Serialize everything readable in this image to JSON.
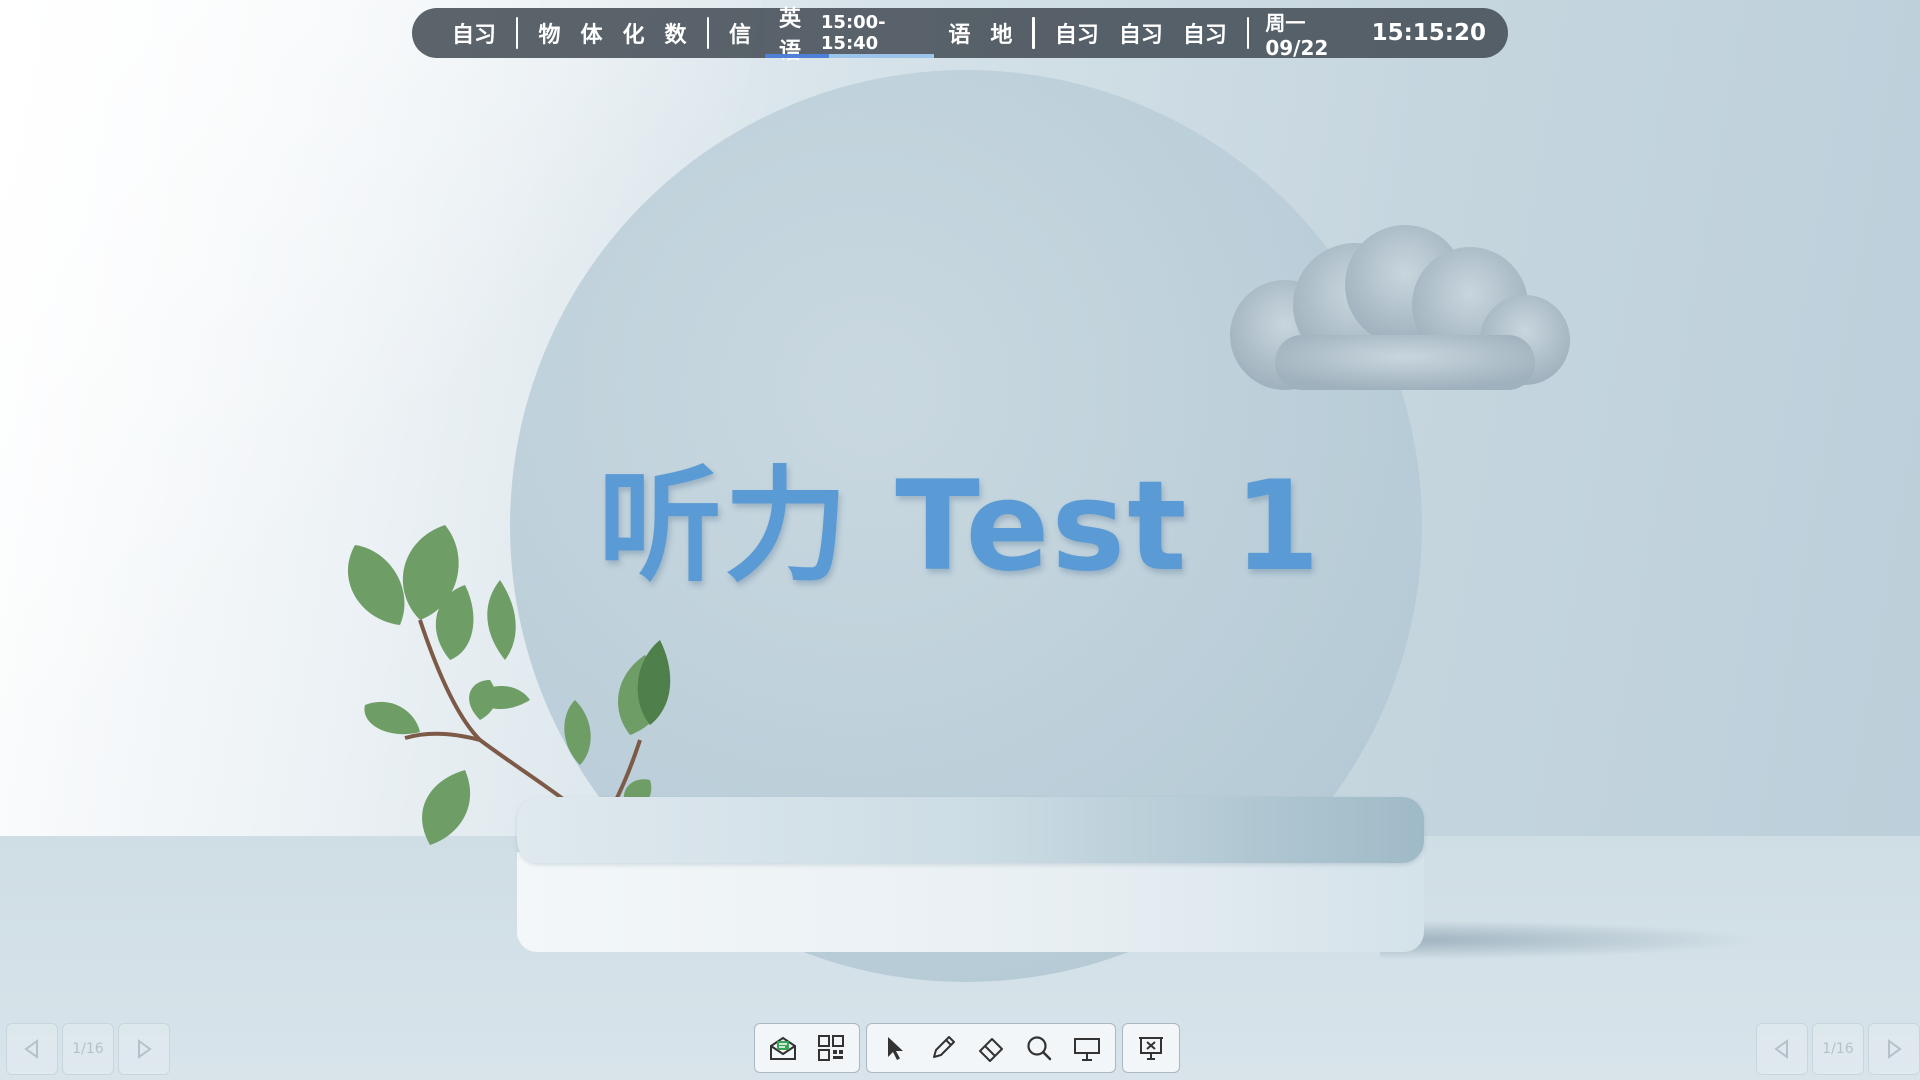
{
  "schedule": {
    "groups": [
      [
        "自习"
      ],
      [
        "物",
        "体",
        "化",
        "数"
      ],
      [
        "信"
      ],
      [
        "语",
        "地"
      ],
      [
        "自习",
        "自习",
        "自习"
      ]
    ],
    "current": {
      "subject": "英语",
      "time": "15:00-15:40",
      "progress": 0.38
    },
    "date": "周一 09/22",
    "clock": "15:15:20",
    "colors": {
      "bar": "#464e56",
      "progress_fill": "#4f7fd6",
      "progress_track": "#9cc3ea"
    }
  },
  "slide": {
    "title": "听力 Test 1",
    "title_color": "#5b9bd5"
  },
  "toolbar": {
    "groups": [
      [
        {
          "icon": "mail-icon",
          "label": "message"
        },
        {
          "icon": "qr-code-icon",
          "label": "qr-code"
        }
      ],
      [
        {
          "icon": "pointer-icon",
          "label": "select"
        },
        {
          "icon": "pen-icon",
          "label": "pen"
        },
        {
          "icon": "eraser-icon",
          "label": "eraser"
        },
        {
          "icon": "search-icon",
          "label": "magnify"
        },
        {
          "icon": "whiteboard-icon",
          "label": "whiteboard"
        }
      ],
      [
        {
          "icon": "close-presentation-icon",
          "label": "end-show"
        }
      ]
    ]
  },
  "pager_left": {
    "page": "1/16"
  },
  "pager_right": {
    "page": "1/16"
  }
}
